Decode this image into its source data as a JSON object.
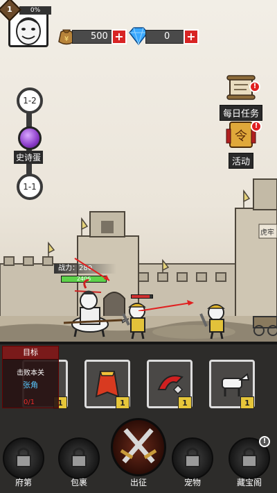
{
  "player": {
    "level": "1",
    "exp_percent_label": "0%",
    "exp_fraction": 0.0
  },
  "resources": {
    "gold": "500",
    "gems": "0",
    "plus": "+"
  },
  "side_buttons": {
    "daily_tasks": "每日任务",
    "events": "活动",
    "badge": "!"
  },
  "stage_map": {
    "upper_node": "1-2",
    "boss_label": "史诗蛋",
    "lower_node": "1-1"
  },
  "battle": {
    "power_label": "战力：",
    "power_value": "280",
    "hero_hp_text": "2406",
    "hero_hp_fraction": 1.0,
    "enemy_hp_fraction": 0.85,
    "gate_sign": "虎牢"
  },
  "objective": {
    "title": "目标",
    "desc": "击败本关",
    "target": "张角",
    "progress": "0/1"
  },
  "inventory": [
    {
      "item": "red-cape",
      "count": "1"
    },
    {
      "item": "red-helmet",
      "count": "1"
    },
    {
      "item": "white-horse",
      "count": "1"
    },
    {
      "item": "hidden",
      "count": "1"
    }
  ],
  "nav": {
    "mansion": "府第",
    "bag": "包裹",
    "battle": "出征",
    "pets": "宠物",
    "treasure": "藏宝阁"
  },
  "colors": {
    "accent_red": "#d82424",
    "hp_green": "#5ed24a",
    "target_blue": "#59c8ff",
    "count_yellow": "#e6c63a"
  }
}
